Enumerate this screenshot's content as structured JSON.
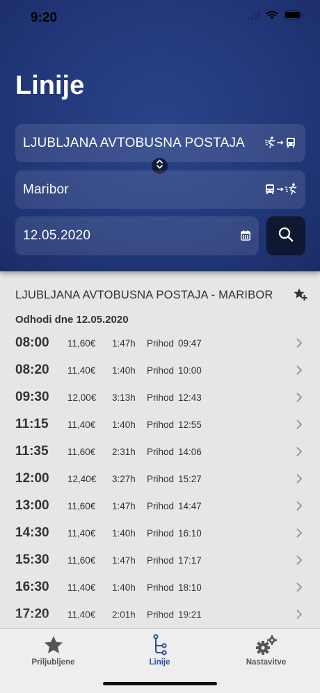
{
  "status": {
    "time": "9:20"
  },
  "header": {
    "title": "Linije",
    "from": {
      "value": "LJUBLJANA AVTOBUSNA POSTAJA",
      "icon": "walk-to-bus-icon"
    },
    "to": {
      "value": "Maribor",
      "icon": "bus-to-walk-icon"
    },
    "date": {
      "value": "12.05.2020",
      "icon": "calendar-icon"
    },
    "search_icon": "search-icon",
    "swap_icon": "swap-vertical-icon"
  },
  "route": {
    "title": "LJUBLJANA AVTOBUSNA POSTAJA - MARIBOR",
    "departures_header": "Odhodi dne 12.05.2020",
    "arrival_label": "Prihod",
    "departures": [
      {
        "time": "08:00",
        "price": "11,60€",
        "duration": "1:47h",
        "arrival": "09:47"
      },
      {
        "time": "08:20",
        "price": "11,40€",
        "duration": "1:40h",
        "arrival": "10:00"
      },
      {
        "time": "09:30",
        "price": "12,00€",
        "duration": "3:13h",
        "arrival": "12:43"
      },
      {
        "time": "11:15",
        "price": "11,40€",
        "duration": "1:40h",
        "arrival": "12:55"
      },
      {
        "time": "11:35",
        "price": "11,60€",
        "duration": "2:31h",
        "arrival": "14:06"
      },
      {
        "time": "12:00",
        "price": "12,40€",
        "duration": "3:27h",
        "arrival": "15:27"
      },
      {
        "time": "13:00",
        "price": "11,60€",
        "duration": "1:47h",
        "arrival": "14:47"
      },
      {
        "time": "14:30",
        "price": "11,40€",
        "duration": "1:40h",
        "arrival": "16:10"
      },
      {
        "time": "15:30",
        "price": "11,60€",
        "duration": "1:47h",
        "arrival": "17:17"
      },
      {
        "time": "16:30",
        "price": "11,40€",
        "duration": "1:40h",
        "arrival": "18:10"
      },
      {
        "time": "17:20",
        "price": "11,40€",
        "duration": "2:01h",
        "arrival": "19:21"
      }
    ]
  },
  "tabs": [
    {
      "label": "Priljubljene",
      "icon": "star-icon",
      "active": false
    },
    {
      "label": "Linije",
      "icon": "route-icon",
      "active": true
    },
    {
      "label": "Nastavitve",
      "icon": "gears-icon",
      "active": false
    }
  ],
  "colors": {
    "header_bg": "#22387a",
    "active_tab": "#2b4d9b",
    "search_button": "#0e1830"
  }
}
